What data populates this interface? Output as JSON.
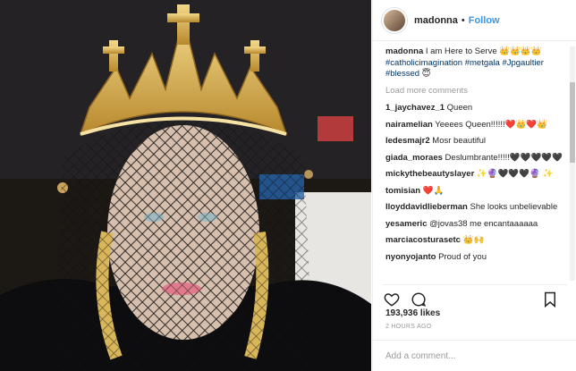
{
  "post": {
    "author": "madonna",
    "dot": "•",
    "follow_label": "Follow",
    "caption_user": "madonna",
    "caption_text": "I am Here to Serve 👑👑👑👑",
    "caption_tags": "#catholicimagination #metgala #Jpgaultier #blessed",
    "caption_tail": "😇",
    "load_more": "Load more comments",
    "likes": "193,936 likes",
    "time": "2 HOURS AGO",
    "add_comment_placeholder": "Add a comment...",
    "comments": [
      {
        "user": "1_jaychavez_1",
        "text": "Queen"
      },
      {
        "user": "nairamelian",
        "text": "Yeeees Queen!!!!!!❤️👑❤️👑"
      },
      {
        "user": "ledesmajr2",
        "text": "Mosr beautiful"
      },
      {
        "user": "giada_moraes",
        "text": "Deslumbrante!!!!!🖤🖤🖤🖤🖤"
      },
      {
        "user": "mickythebeautyslayer",
        "text": "✨🔮🖤🖤🖤🔮 ✨"
      },
      {
        "user": "tomisian",
        "text": "❤️🙏"
      },
      {
        "user": "lloyddavidlieberman",
        "text": "She looks unbelievable"
      },
      {
        "user": "yesameric",
        "text": "@jovas38 me encantaaaaaa"
      },
      {
        "user": "marciacosturasetc",
        "text": "👑🙌"
      },
      {
        "user": "nyonyojanto",
        "text": "Proud of you"
      }
    ]
  },
  "icons": [
    "heart-icon",
    "comment-icon",
    "bookmark-icon"
  ],
  "colors": {
    "link": "#3897f0",
    "hashtag": "#003569",
    "muted": "#999999"
  }
}
